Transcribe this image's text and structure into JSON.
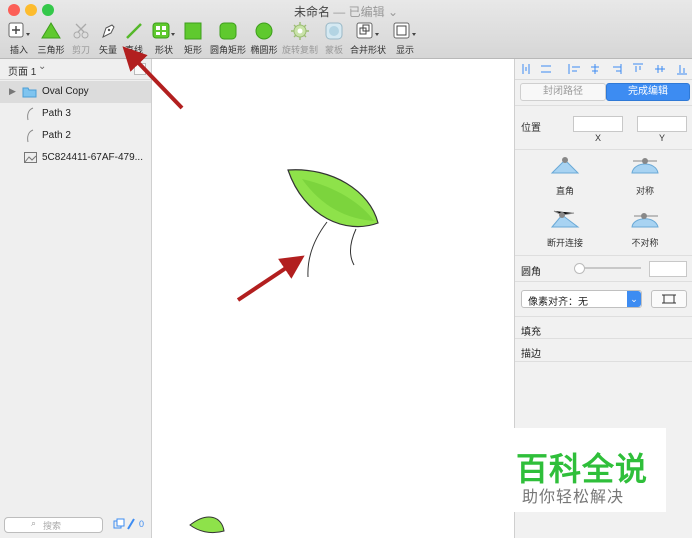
{
  "window": {
    "title": "未命名",
    "subtitle": "— 已编辑",
    "colors": {
      "close": "#fc5f57",
      "minimize": "#fdbc2e",
      "zoom": "#34c84a"
    }
  },
  "toolbar": {
    "insert": "插入",
    "triangle": "三角形",
    "scissors": "剪刀",
    "vector": "矢量",
    "line": "直线",
    "shape": "形状",
    "rectangle": "矩形",
    "rounded_rect": "圆角矩形",
    "oval": "椭圆形",
    "rotate_copy": "旋转复制",
    "mask": "蒙板",
    "combine": "合并形状",
    "display": "显示"
  },
  "left_panel": {
    "page_selector": "页面 1",
    "layers": [
      {
        "name": "Oval Copy",
        "kind": "folder-icon"
      },
      {
        "name": "Path 3",
        "kind": "path-icon"
      },
      {
        "name": "Path 2",
        "kind": "path-icon"
      },
      {
        "name": "5C824411-67AF-479...",
        "kind": "image-icon"
      }
    ],
    "search_placeholder": "搜索",
    "badge_count": "0"
  },
  "right_panel": {
    "close_path": "封闭路径",
    "finish_edit": "完成编辑",
    "position_label": "位置",
    "x_label": "X",
    "y_label": "Y",
    "vertex_types": [
      "直角",
      "对称",
      "断开连接",
      "不对称"
    ],
    "corner_label": "圆角",
    "pixel_align": "像素对齐：无",
    "fill_label": "填充",
    "border_label": "描边"
  },
  "watermark": {
    "main": "百科全说",
    "sub": "助你轻松解决",
    "color": "#2fbf3a"
  },
  "colors": {
    "accent": "#3d8cf2",
    "leaf": "#8ee24a",
    "arrow": "#b21f1f"
  }
}
